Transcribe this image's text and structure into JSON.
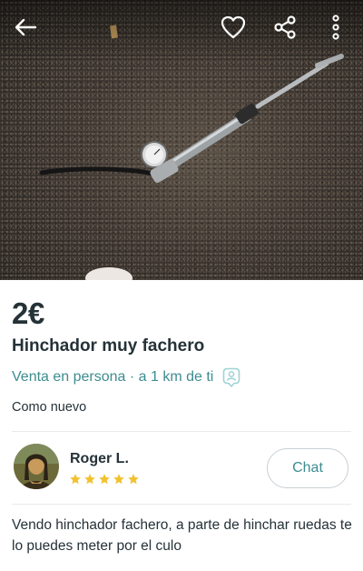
{
  "listing": {
    "price": "2€",
    "title": "Hinchador muy fachero",
    "delivery": "Venta en persona · a 1 km de ti",
    "condition": "Como nuevo",
    "description": "Vendo hinchador fachero, a parte de hinchar ruedas te lo puedes meter por el culo"
  },
  "seller": {
    "name": "Roger L.",
    "rating": 5
  },
  "actions": {
    "chat_label": "Chat"
  },
  "icons": {
    "back": "arrow-left-icon",
    "favorite": "heart-icon",
    "share": "share-icon",
    "more": "more-vertical-icon",
    "delivery": "person-pin-icon",
    "star": "star-icon"
  },
  "colors": {
    "accent": "#3c8c90",
    "star": "#f2c12e",
    "text": "#253238"
  }
}
